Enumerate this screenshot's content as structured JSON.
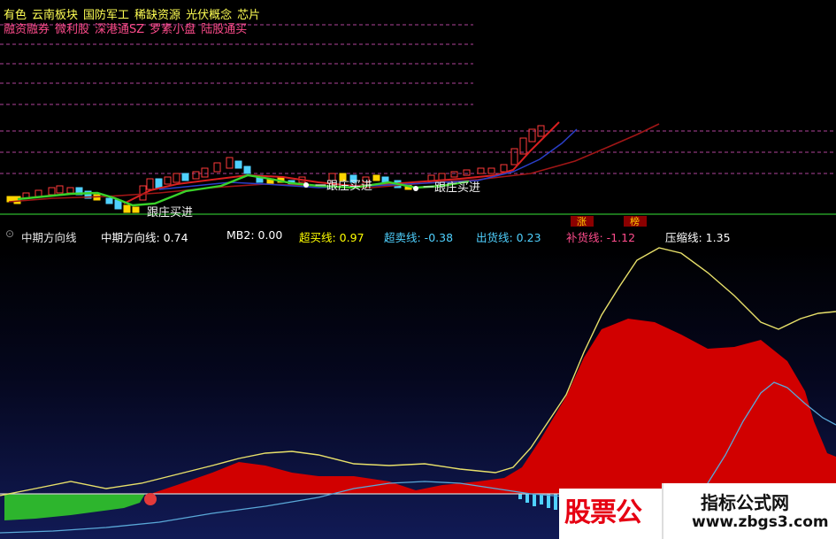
{
  "concept_tags_row1": [
    "有色",
    "云南板块",
    "国防军工",
    "稀缺资源",
    "光伏概念",
    "芯片"
  ],
  "concept_tags_row2": [
    "融资融券",
    "微利股",
    "深港通SZ",
    "罗素小盘",
    "陆股通买"
  ],
  "signals": {
    "follow_buy_1": "跟庄买进",
    "follow_buy_2": "一跟庄买进",
    "follow_buy_3": "一跟庄买进",
    "marker_zhang": "涨",
    "marker_bang": "榜"
  },
  "indicator": {
    "collapse_icon": "chevron-down-icon",
    "name": "中期方向线",
    "values": [
      {
        "label": "中期方向线",
        "value": "0.74",
        "color": "#ffffff"
      },
      {
        "label": "MB2",
        "value": "0.00",
        "color": "#ffffff"
      },
      {
        "label": "超买线",
        "value": "0.97",
        "color": "#ffff00"
      },
      {
        "label": "超卖线",
        "value": "-0.38",
        "color": "#4fd1ff"
      },
      {
        "label": "出货线",
        "value": "0.23",
        "color": "#4fd1ff"
      },
      {
        "label": "补货线",
        "value": "-1.12",
        "color": "#ff4c8c"
      },
      {
        "label": "压缩线",
        "value": "1.35",
        "color": "#ffffff"
      }
    ]
  },
  "watermarks": {
    "left_brand": "股票公",
    "right_title": "指标公式网",
    "right_url": "www.zbgs3.com"
  },
  "colors": {
    "rising_fill": "#d10000",
    "falling_fill": "#2db52d",
    "compression_line": "#e8e06a",
    "outflow_line": "#5aa8d8",
    "grid_dash": "#b0459a",
    "baseline_green": "#2eb82e"
  }
}
